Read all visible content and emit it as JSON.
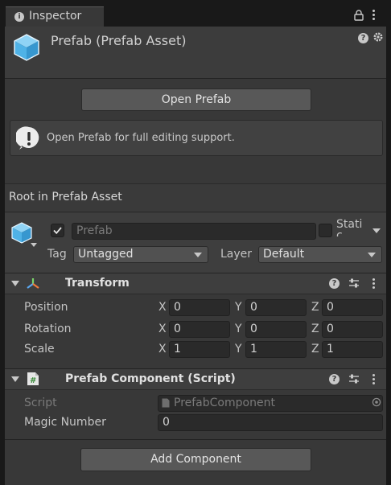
{
  "tab": {
    "title": "Inspector"
  },
  "header": {
    "title": "Prefab (Prefab Asset)"
  },
  "open_prefab": {
    "label": "Open Prefab"
  },
  "help_message": "Open Prefab for full editing support.",
  "root_label": "Root in Prefab Asset",
  "gameobject": {
    "name": "Prefab",
    "static_label": "Static",
    "tag_label": "Tag",
    "tag_value": "Untagged",
    "layer_label": "Layer",
    "layer_value": "Default"
  },
  "transform": {
    "title": "Transform",
    "rows": [
      {
        "label": "Position",
        "x": "0",
        "y": "0",
        "z": "0"
      },
      {
        "label": "Rotation",
        "x": "0",
        "y": "0",
        "z": "0"
      },
      {
        "label": "Scale",
        "x": "1",
        "y": "1",
        "z": "1"
      }
    ],
    "axis": {
      "x": "X",
      "y": "Y",
      "z": "Z"
    }
  },
  "prefab_component": {
    "title": "Prefab Component (Script)",
    "script_label": "Script",
    "script_value": "PrefabComponent",
    "magic_label": "Magic Number",
    "magic_value": "0"
  },
  "add_component": {
    "label": "Add Component"
  }
}
